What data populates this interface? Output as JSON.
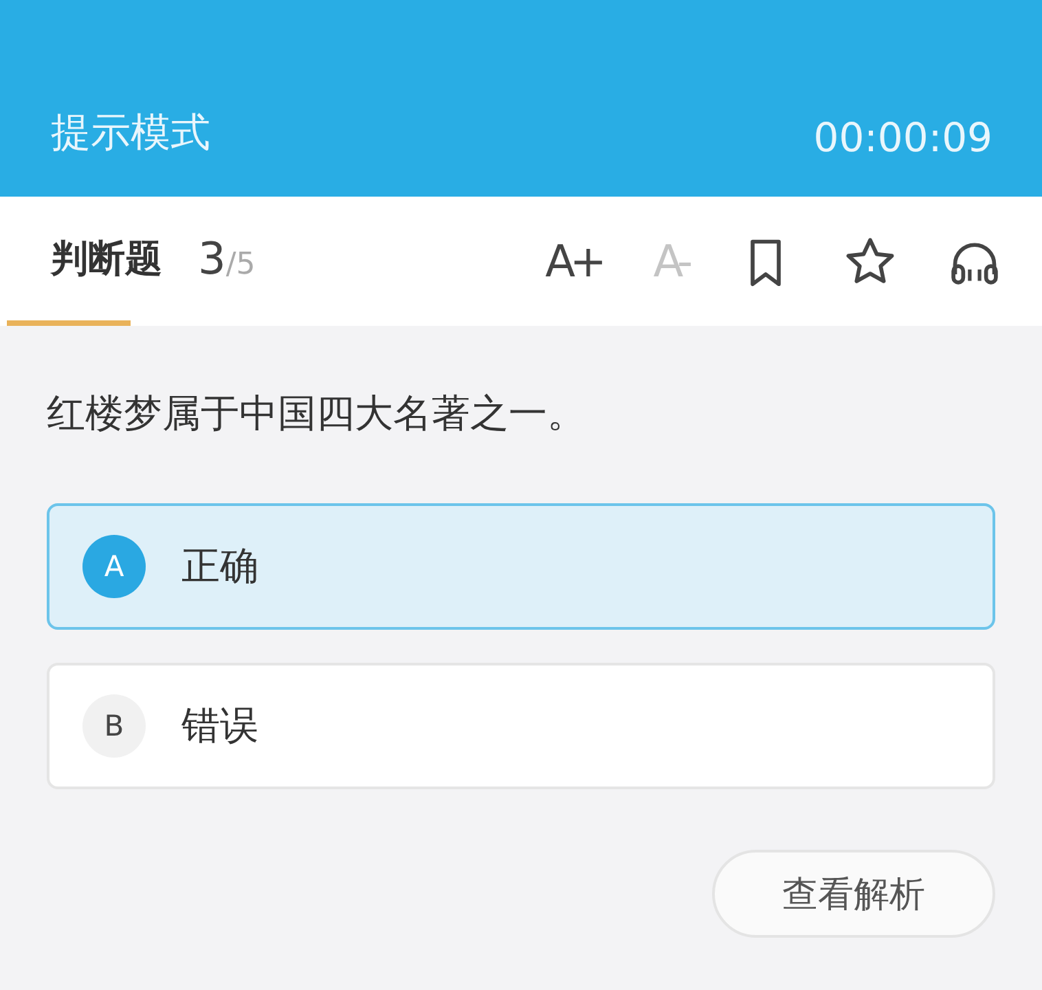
{
  "header": {
    "title": "提示模式",
    "timer": "00:00:09"
  },
  "toolbar": {
    "type_label": "判断题",
    "current": "3",
    "total": "/5",
    "tab_selected": true,
    "tools": [
      {
        "kind": "text",
        "label": "A+",
        "disabled": false
      },
      {
        "kind": "text",
        "label": "A-",
        "disabled": true
      },
      {
        "kind": "bookmark",
        "disabled": false
      },
      {
        "kind": "star",
        "disabled": false
      },
      {
        "kind": "headphones",
        "disabled": false
      }
    ]
  },
  "question": "红楼梦属于中国四大名著之一。",
  "options": [
    {
      "letter": "A",
      "text": "正确",
      "selected": true
    },
    {
      "letter": "B",
      "text": "错误",
      "selected": false
    }
  ],
  "analysis_button": "查看解析"
}
